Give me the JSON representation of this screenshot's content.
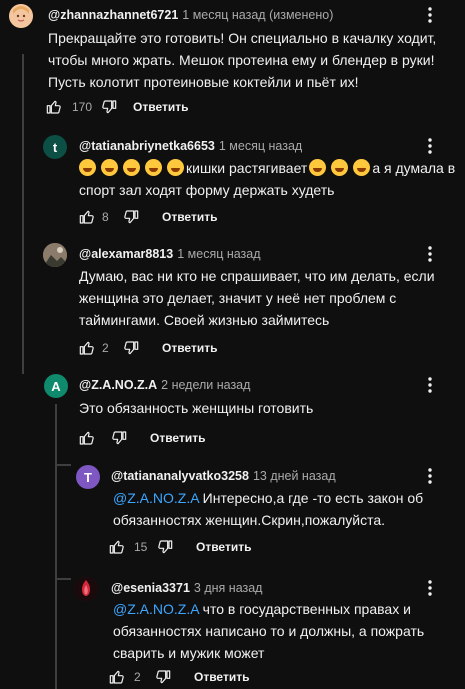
{
  "comments": [
    {
      "author": "@zhannazhannet6721",
      "time": "1 месяц назад (изменено)",
      "lines": [
        "Прекращайте это готовить! Он специально в качалку ходит,",
        "чтобы много жрать. Мешок протеина ему и блендер в руки!",
        "Пусть колотит протеиновые коктейли и пьёт их!"
      ],
      "likes": "170",
      "reply": "Ответить",
      "avatar_color": "#e8a860",
      "avatar_letter": ""
    },
    {
      "author": "@tatianabriynetka6653",
      "time": "1 месяц назад",
      "line1_text": "кишки растягивает",
      "line1_tail": "а я думала в",
      "line2": "спорт зал ходят форму держать худеть",
      "likes": "8",
      "reply": "Ответить",
      "avatar_color": "#0b4f45",
      "avatar_letter": "t"
    },
    {
      "author": "@alexamar8813",
      "time": "1 месяц назад",
      "lines": [
        "Думаю, вас ни кто не спрашивает, что им делать, если",
        "женщина это делает, значит у неё нет проблем с",
        "таймингами. Своей жизнью займитесь"
      ],
      "likes": "2",
      "reply": "Ответить",
      "avatar_color": "#7a6a5a",
      "avatar_letter": ""
    },
    {
      "author": "@Z.A.NO.Z.A",
      "time": "2 недели назад",
      "lines": [
        "Это обязанность женщины готовить"
      ],
      "likes": "",
      "reply": "Ответить",
      "avatar_color": "#0f8a6c",
      "avatar_letter": "A"
    },
    {
      "author": "@tatiananalyvatko3258",
      "time": "13 дней назад",
      "mention": "@Z.A.NO.Z.A",
      "line1_text": " Интересно,а где -то есть закон об",
      "line2": "обязанностях женщин.Скрин,пожалуйста.",
      "likes": "15",
      "reply": "Ответить",
      "avatar_color": "#7e57c2",
      "avatar_letter": "T"
    },
    {
      "author": "@esenia3371",
      "time": "3 дня назад",
      "mention": "@Z.A.NO.Z.A",
      "line1_text": "  что в государственных правах и",
      "line2": "обязанностях написано то и должны,  а пожрать",
      "line3": "сварить и мужик может",
      "likes": "2",
      "reply": "Ответить",
      "avatar_color": "#3a1518",
      "avatar_letter": ""
    }
  ],
  "colors": {
    "background": "#0f0f0f",
    "text": "#f1f1f1",
    "secondary": "#aaaaaa",
    "mention": "#3ea6ff",
    "thread": "#3f3f3f"
  },
  "icons": [
    "thumb-up-icon",
    "thumb-down-icon",
    "more-vert-icon",
    "laughing-emoji-icon"
  ]
}
